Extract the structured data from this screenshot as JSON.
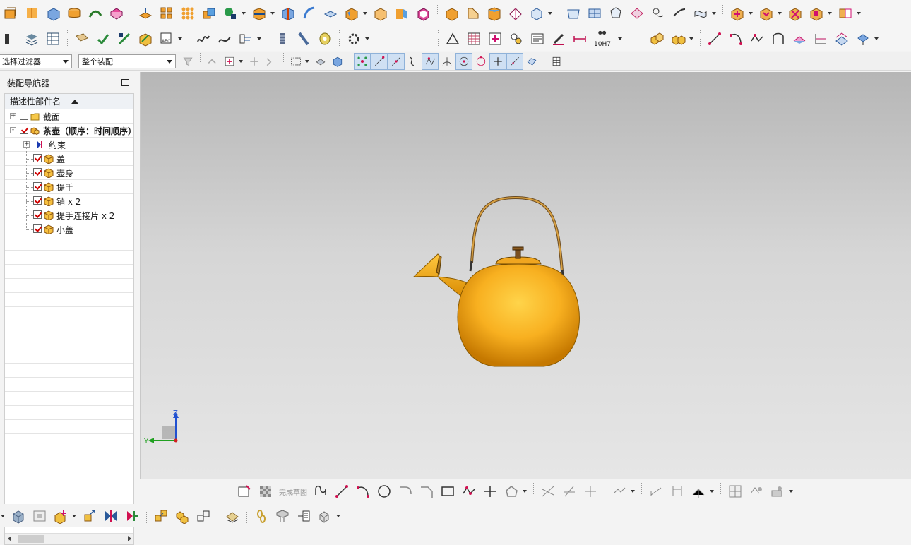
{
  "toolbar": {
    "selection_filter": "选择过滤器",
    "scope": "整个装配",
    "fit_tolerance_label": "10H7"
  },
  "navigator": {
    "title": "装配导航器",
    "column_header": "描述性部件名",
    "rows": [
      {
        "label": "截面",
        "level": 0,
        "expand": "+",
        "checked": false,
        "icon": "folder-icon"
      },
      {
        "label": "茶壶（顺序：时间顺序）",
        "level": 0,
        "expand": "-",
        "checked": true,
        "icon": "assembly-icon",
        "bold": true
      },
      {
        "label": "约束",
        "level": 1,
        "expand": "+",
        "checked": null,
        "icon": "constraint-icon"
      },
      {
        "label": "盖",
        "level": 1,
        "checked": true,
        "icon": "part-icon"
      },
      {
        "label": "壶身",
        "level": 1,
        "checked": true,
        "icon": "part-icon"
      },
      {
        "label": "提手",
        "level": 1,
        "checked": true,
        "icon": "part-icon"
      },
      {
        "label": "销 x 2",
        "level": 1,
        "checked": true,
        "icon": "part-icon"
      },
      {
        "label": "提手连接片 x 2",
        "level": 1,
        "checked": true,
        "icon": "part-icon"
      },
      {
        "label": "小盖",
        "level": 1,
        "checked": true,
        "icon": "part-icon"
      }
    ]
  },
  "triad": {
    "z": "Z",
    "y": "Y"
  },
  "sketch": {
    "finish_label": "完成草图"
  },
  "colors": {
    "part": "#f0a81e",
    "check": "#d00000",
    "viewport_top": "#b6b6b6",
    "viewport_bottom": "#e6e6e6"
  }
}
